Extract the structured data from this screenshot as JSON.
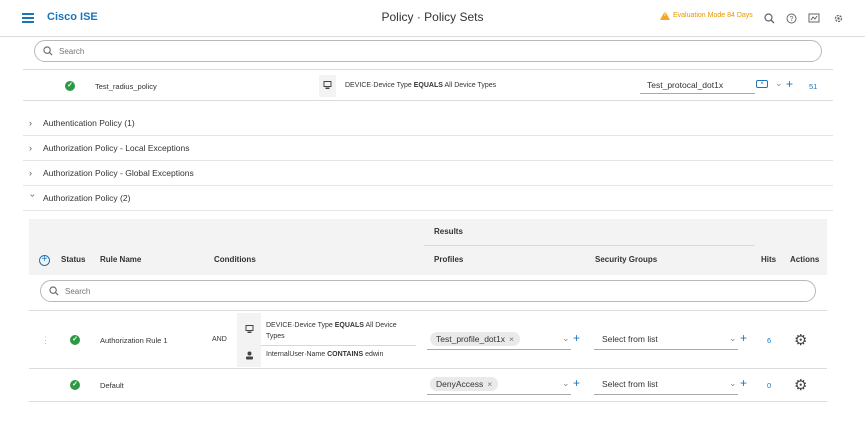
{
  "app": {
    "brand": "Cisco ISE",
    "page_title": "Policy · Policy Sets"
  },
  "header": {
    "eval_text": "Evaluation Mode 84 Days"
  },
  "policy_set_search": {
    "placeholder": "Search"
  },
  "policy_set": {
    "name": "Test_radius_policy",
    "condition_prefix": "DEVICE·Device Type",
    "condition_operator": "EQUALS",
    "condition_value": "All Device Types",
    "protocol": "Test_protocal_dot1x",
    "hits": "51"
  },
  "sections": [
    {
      "label": "Authentication Policy (1)"
    },
    {
      "label": "Authorization Policy - Local Exceptions"
    },
    {
      "label": "Authorization Policy - Global Exceptions"
    },
    {
      "label": "Authorization Policy (2)"
    }
  ],
  "table": {
    "results_header": "Results",
    "columns": {
      "status": "Status",
      "rule_name": "Rule Name",
      "conditions": "Conditions",
      "profiles": "Profiles",
      "security_groups": "Security Groups",
      "hits": "Hits",
      "actions": "Actions"
    },
    "search_placeholder": "Search"
  },
  "rules": [
    {
      "name": "Authorization Rule 1",
      "operator": "AND",
      "cond1_prefix": "DEVICE·Device Type",
      "cond1_op": "EQUALS",
      "cond1_value": "All Device Types",
      "cond2_prefix": "InternalUser·Name",
      "cond2_op": "CONTAINS",
      "cond2_value": "edwin",
      "profile": "Test_profile_dot1x",
      "security_group": "Select from list",
      "hits": "6"
    },
    {
      "name": "Default",
      "profile": "DenyAccess",
      "security_group": "Select from list",
      "hits": "0"
    }
  ],
  "colors": {
    "accent": "#1b75bb",
    "success": "#2c9a45",
    "warning": "#e59500"
  }
}
